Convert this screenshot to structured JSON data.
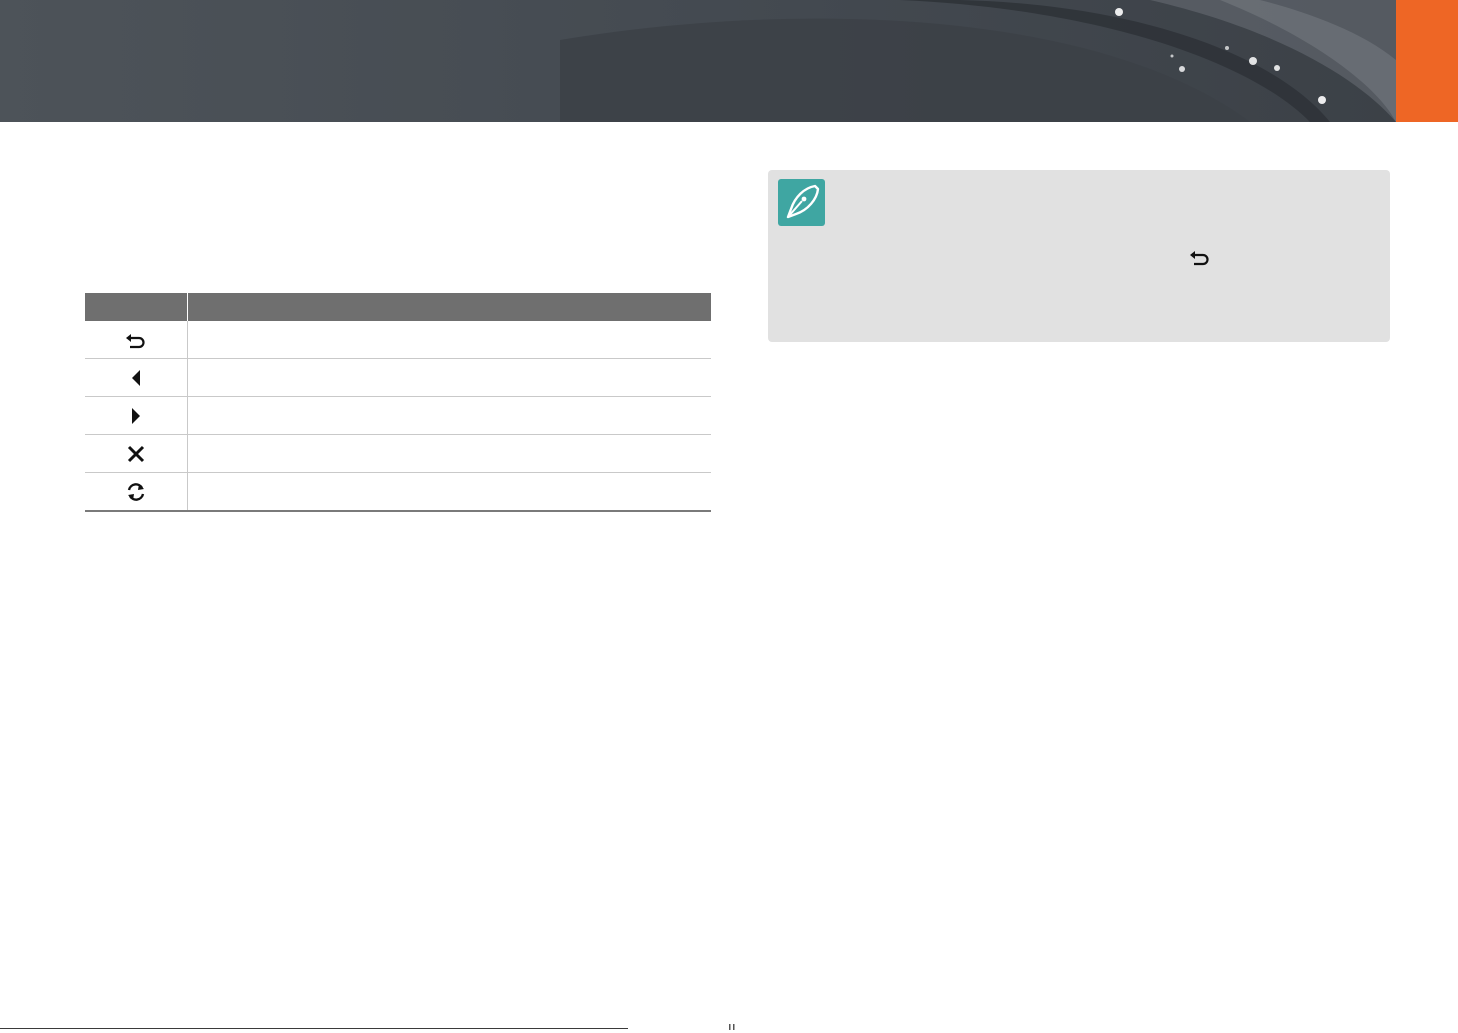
{
  "header": {
    "accent_color": "#ee6625",
    "banner_color": "#4a5056"
  },
  "table": {
    "header": [
      "",
      ""
    ],
    "rows": [
      {
        "icon": "back-arrow-icon",
        "text": ""
      },
      {
        "icon": "triangle-left-icon",
        "text": ""
      },
      {
        "icon": "triangle-right-icon",
        "text": ""
      },
      {
        "icon": "close-x-icon",
        "text": ""
      },
      {
        "icon": "refresh-icon",
        "text": ""
      }
    ]
  },
  "note": {
    "icon": "pen-nib-icon",
    "inline_icon": "back-arrow-icon",
    "background": "#e1e1e1",
    "icon_color": "#3fa6a2"
  }
}
